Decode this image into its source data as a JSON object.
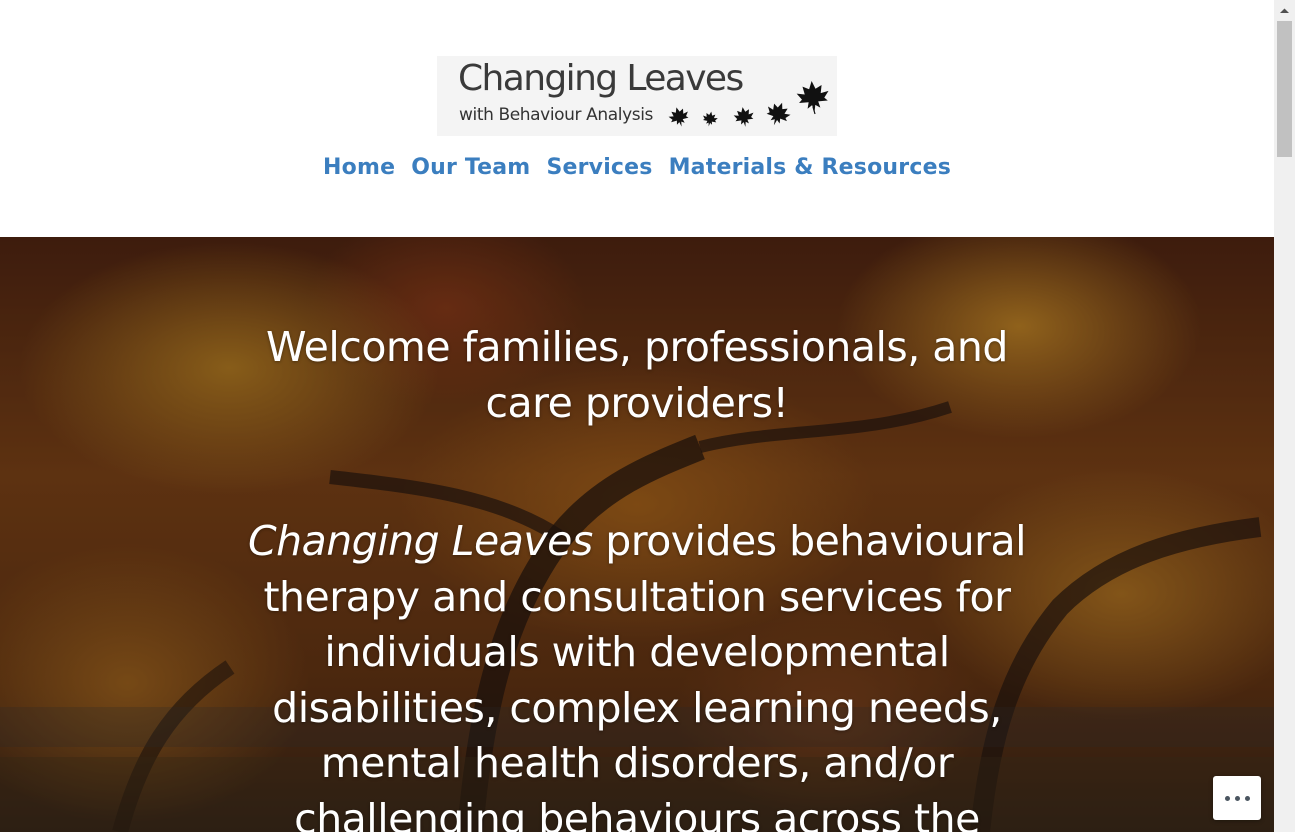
{
  "header": {
    "logo_title": "Changing Leaves",
    "logo_subtitle": "with Behaviour Analysis"
  },
  "nav": {
    "items": [
      {
        "label": "Home"
      },
      {
        "label": "Our Team"
      },
      {
        "label": "Services"
      },
      {
        "label": "Materials & Resources"
      }
    ]
  },
  "hero": {
    "title": "Welcome families, professionals, and care providers!",
    "body_emphasis": "Changing Leaves",
    "body_text": " provides behavioural therapy and consultation services for individuals with developmental disabilities, complex learning needs, mental health disorders, and/or challenging behaviours across the"
  },
  "colors": {
    "nav_link": "#3b7ebf",
    "hero_text": "#ffffff",
    "header_bg": "#ffffff"
  },
  "icons": {
    "more_button": "ellipsis-icon",
    "logo_decoration": "maple-leaf-icon"
  }
}
